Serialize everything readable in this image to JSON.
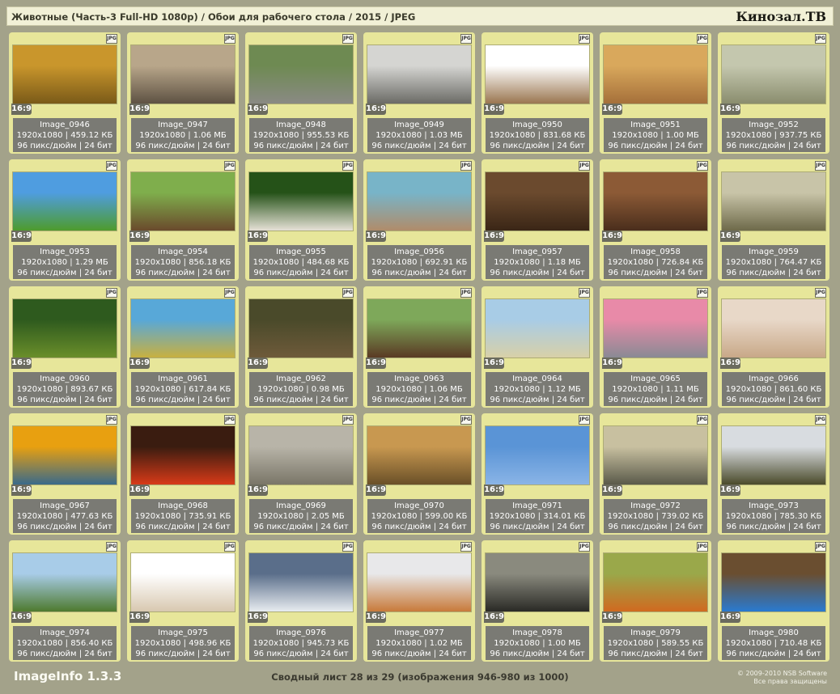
{
  "header": {
    "title": "Животные (Часть-3 Full-HD 1080p) / Обои для рабочего стола / 2015 / JPEG",
    "site": "Кинозал.ТВ"
  },
  "footer": {
    "app": "ImageInfo 1.3.3",
    "summary": "Сводный лист 28 из 29 (изображения 946-980 из 1000)",
    "copyright_line1": "© 2009-2010 NSB Software",
    "copyright_line2": "Все права защищены"
  },
  "common": {
    "ratio": "16:9",
    "jpg_badge": "JPG"
  },
  "items": [
    {
      "name": "Image_0946",
      "line1": "1920x1080 | 459.12 КБ",
      "line2": "96 пикс/дюйм | 24 бит",
      "colors": [
        "#c9962c",
        "#7a5a18"
      ]
    },
    {
      "name": "Image_0947",
      "line1": "1920x1080 | 1.06 МБ",
      "line2": "96 пикс/дюйм | 24 бит",
      "colors": [
        "#b8a68a",
        "#5e5243"
      ]
    },
    {
      "name": "Image_0948",
      "line1": "1920x1080 | 955.53 КБ",
      "line2": "96 пикс/дюйм | 24 бит",
      "colors": [
        "#6e8a52",
        "#8a8a84"
      ]
    },
    {
      "name": "Image_0949",
      "line1": "1920x1080 | 1.03 МБ",
      "line2": "96 пикс/дюйм | 24 бит",
      "colors": [
        "#d5d5d2",
        "#6b6b66"
      ]
    },
    {
      "name": "Image_0950",
      "line1": "1920x1080 | 831.68 КБ",
      "line2": "96 пикс/дюйм | 24 бит",
      "colors": [
        "#ffffff",
        "#9a7650"
      ]
    },
    {
      "name": "Image_0951",
      "line1": "1920x1080 | 1.00 МБ",
      "line2": "96 пикс/дюйм | 24 бит",
      "colors": [
        "#d9a85c",
        "#a5703a"
      ]
    },
    {
      "name": "Image_0952",
      "line1": "1920x1080 | 937.75 КБ",
      "line2": "96 пикс/дюйм | 24 бит",
      "colors": [
        "#c4c7ae",
        "#8a8d6e"
      ]
    },
    {
      "name": "Image_0953",
      "line1": "1920x1080 | 1.29 МБ",
      "line2": "96 пикс/дюйм | 24 бит",
      "colors": [
        "#4f9de0",
        "#4e9b2c"
      ]
    },
    {
      "name": "Image_0954",
      "line1": "1920x1080 | 856.18 КБ",
      "line2": "96 пикс/дюйм | 24 бит",
      "colors": [
        "#7fae4c",
        "#6a4a2c"
      ]
    },
    {
      "name": "Image_0955",
      "line1": "1920x1080 | 484.68 КБ",
      "line2": "96 пикс/дюйм | 24 бит",
      "colors": [
        "#255218",
        "#e6e1d6"
      ]
    },
    {
      "name": "Image_0956",
      "line1": "1920x1080 | 692.91 КБ",
      "line2": "96 пикс/дюйм | 24 бит",
      "colors": [
        "#78b4c8",
        "#b08c6a"
      ]
    },
    {
      "name": "Image_0957",
      "line1": "1920x1080 | 1.18 МБ",
      "line2": "96 пикс/дюйм | 24 бит",
      "colors": [
        "#6b4a2e",
        "#3a2616"
      ]
    },
    {
      "name": "Image_0958",
      "line1": "1920x1080 | 726.84 КБ",
      "line2": "96 пикс/дюйм | 24 бит",
      "colors": [
        "#8c5a36",
        "#4a2e1c"
      ]
    },
    {
      "name": "Image_0959",
      "line1": "1920x1080 | 764.47 КБ",
      "line2": "96 пикс/дюйм | 24 бит",
      "colors": [
        "#c8c4a8",
        "#6e6a4a"
      ]
    },
    {
      "name": "Image_0960",
      "line1": "1920x1080 | 893.67 КБ",
      "line2": "96 пикс/дюйм | 24 бит",
      "colors": [
        "#2e5a1e",
        "#6a8e2a"
      ]
    },
    {
      "name": "Image_0961",
      "line1": "1920x1080 | 617.84 КБ",
      "line2": "96 пикс/дюйм | 24 бит",
      "colors": [
        "#58a8d8",
        "#c8b040"
      ]
    },
    {
      "name": "Image_0962",
      "line1": "1920x1080 | 0.98 МБ",
      "line2": "96 пикс/дюйм | 24 бит",
      "colors": [
        "#4a4a2a",
        "#6e5a3a"
      ]
    },
    {
      "name": "Image_0963",
      "line1": "1920x1080 | 1.06 МБ",
      "line2": "96 пикс/дюйм | 24 бит",
      "colors": [
        "#7ea85a",
        "#5a3a24"
      ]
    },
    {
      "name": "Image_0964",
      "line1": "1920x1080 | 1.12 МБ",
      "line2": "96 пикс/дюйм | 24 бит",
      "colors": [
        "#a8cce6",
        "#d8d0a8"
      ]
    },
    {
      "name": "Image_0965",
      "line1": "1920x1080 | 1.11 МБ",
      "line2": "96 пикс/дюйм | 24 бит",
      "colors": [
        "#e88aa8",
        "#8a8a94"
      ]
    },
    {
      "name": "Image_0966",
      "line1": "1920x1080 | 861.60 КБ",
      "line2": "96 пикс/дюйм | 24 бит",
      "colors": [
        "#e8d8c8",
        "#c8a888"
      ]
    },
    {
      "name": "Image_0967",
      "line1": "1920x1080 | 477.63 КБ",
      "line2": "96 пикс/дюйм | 24 бит",
      "colors": [
        "#e8a010",
        "#3a6a8a"
      ]
    },
    {
      "name": "Image_0968",
      "line1": "1920x1080 | 735.91 КБ",
      "line2": "96 пикс/дюйм | 24 бит",
      "colors": [
        "#3a1c10",
        "#d83a18"
      ]
    },
    {
      "name": "Image_0969",
      "line1": "1920x1080 | 2.05 МБ",
      "line2": "96 пикс/дюйм | 24 бит",
      "colors": [
        "#b8b4a8",
        "#7a7668"
      ]
    },
    {
      "name": "Image_0970",
      "line1": "1920x1080 | 599.00 КБ",
      "line2": "96 пикс/дюйм | 24 бит",
      "colors": [
        "#c89850",
        "#6a5028"
      ]
    },
    {
      "name": "Image_0971",
      "line1": "1920x1080 | 314.01 КБ",
      "line2": "96 пикс/дюйм | 24 бит",
      "colors": [
        "#5a94d6",
        "#8ab4e6"
      ]
    },
    {
      "name": "Image_0972",
      "line1": "1920x1080 | 739.02 КБ",
      "line2": "96 пикс/дюйм | 24 бит",
      "colors": [
        "#c8c0a0",
        "#5a5a4a"
      ]
    },
    {
      "name": "Image_0973",
      "line1": "1920x1080 | 785.30 КБ",
      "line2": "96 пикс/дюйм | 24 бит",
      "colors": [
        "#d8dce0",
        "#4a4a2a"
      ]
    },
    {
      "name": "Image_0974",
      "line1": "1920x1080 | 856.40 КБ",
      "line2": "96 пикс/дюйм | 24 бит",
      "colors": [
        "#a8cce8",
        "#4e7a2e"
      ]
    },
    {
      "name": "Image_0975",
      "line1": "1920x1080 | 498.96 КБ",
      "line2": "96 пикс/дюйм | 24 бит",
      "colors": [
        "#ffffff",
        "#d8c8b0"
      ]
    },
    {
      "name": "Image_0976",
      "line1": "1920x1080 | 945.73 КБ",
      "line2": "96 пикс/дюйм | 24 бит",
      "colors": [
        "#5a6e8a",
        "#e8ecf0"
      ]
    },
    {
      "name": "Image_0977",
      "line1": "1920x1080 | 1.02 МБ",
      "line2": "96 пикс/дюйм | 24 бит",
      "colors": [
        "#e8e8ea",
        "#c87a3a"
      ]
    },
    {
      "name": "Image_0978",
      "line1": "1920x1080 | 1.00 МБ",
      "line2": "96 пикс/дюйм | 24 бит",
      "colors": [
        "#8a8a7e",
        "#2a2a26"
      ]
    },
    {
      "name": "Image_0979",
      "line1": "1920x1080 | 589.55 КБ",
      "line2": "96 пикс/дюйм | 24 бит",
      "colors": [
        "#9aa84a",
        "#d06a20"
      ]
    },
    {
      "name": "Image_0980",
      "line1": "1920x1080 | 710.48 КБ",
      "line2": "96 пикс/дюйм | 24 бит",
      "colors": [
        "#6a4e30",
        "#2a7ad0"
      ]
    }
  ]
}
